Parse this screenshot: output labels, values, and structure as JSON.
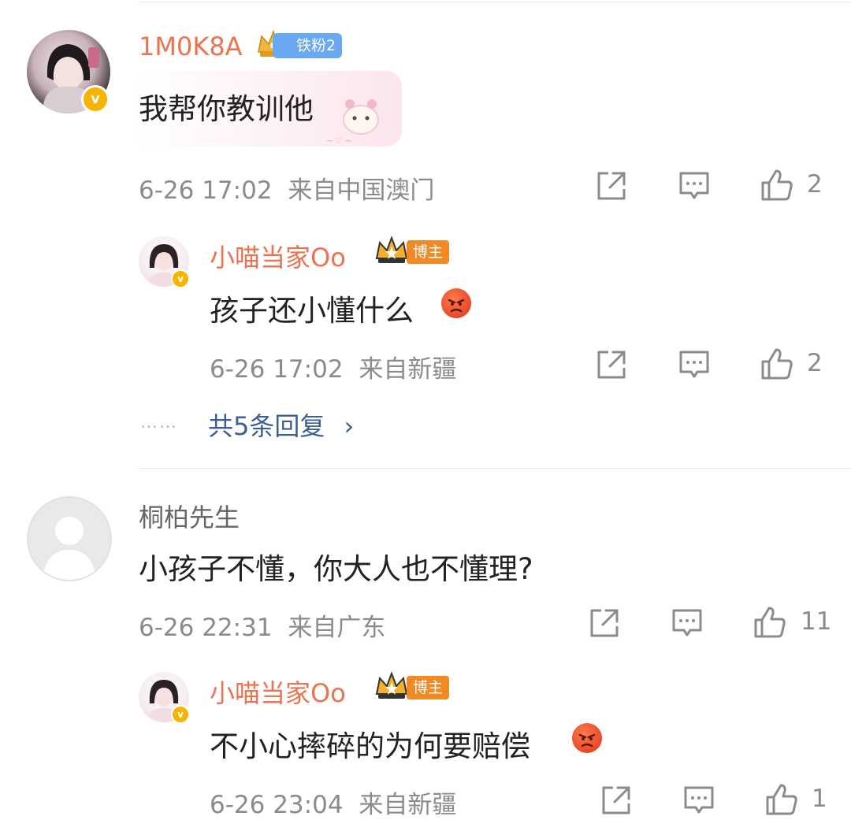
{
  "comments": [
    {
      "username": "1M0K8A",
      "fan_badge": "铁粉2",
      "text": "我帮你教训他",
      "time": "6-26 17:02",
      "location": "来自中国澳门",
      "likes": "2"
    },
    {
      "username": "桐柏先生",
      "text": "小孩子不懂，你大人也不懂理?",
      "time": "6-26 22:31",
      "location": "来自广东",
      "likes": "11"
    }
  ],
  "replies": [
    {
      "username": "小喵当家Oo",
      "badge": "博主",
      "text": "孩子还小懂什么",
      "time": "6-26 17:02",
      "location": "来自新疆",
      "likes": "2"
    },
    {
      "username": "小喵当家Oo",
      "badge": "博主",
      "text": "不小心摔碎的为何要赔偿",
      "time": "6-26 23:04",
      "location": "来自新疆",
      "likes": "1"
    }
  ],
  "more_replies": {
    "dots": "……",
    "label": "共5条回复",
    "chevron": "›"
  },
  "icons": {
    "share": "share-icon",
    "comment": "comment-icon",
    "like": "thumbs-up-icon"
  },
  "colors": {
    "username_orange": "#eb7350",
    "link_blue": "#3b5f93",
    "meta_gray": "#8b8b8b",
    "verified_gold": "#f5b400",
    "blogger_badge": "#f08a24",
    "fan_badge": "#6aa9f0"
  }
}
